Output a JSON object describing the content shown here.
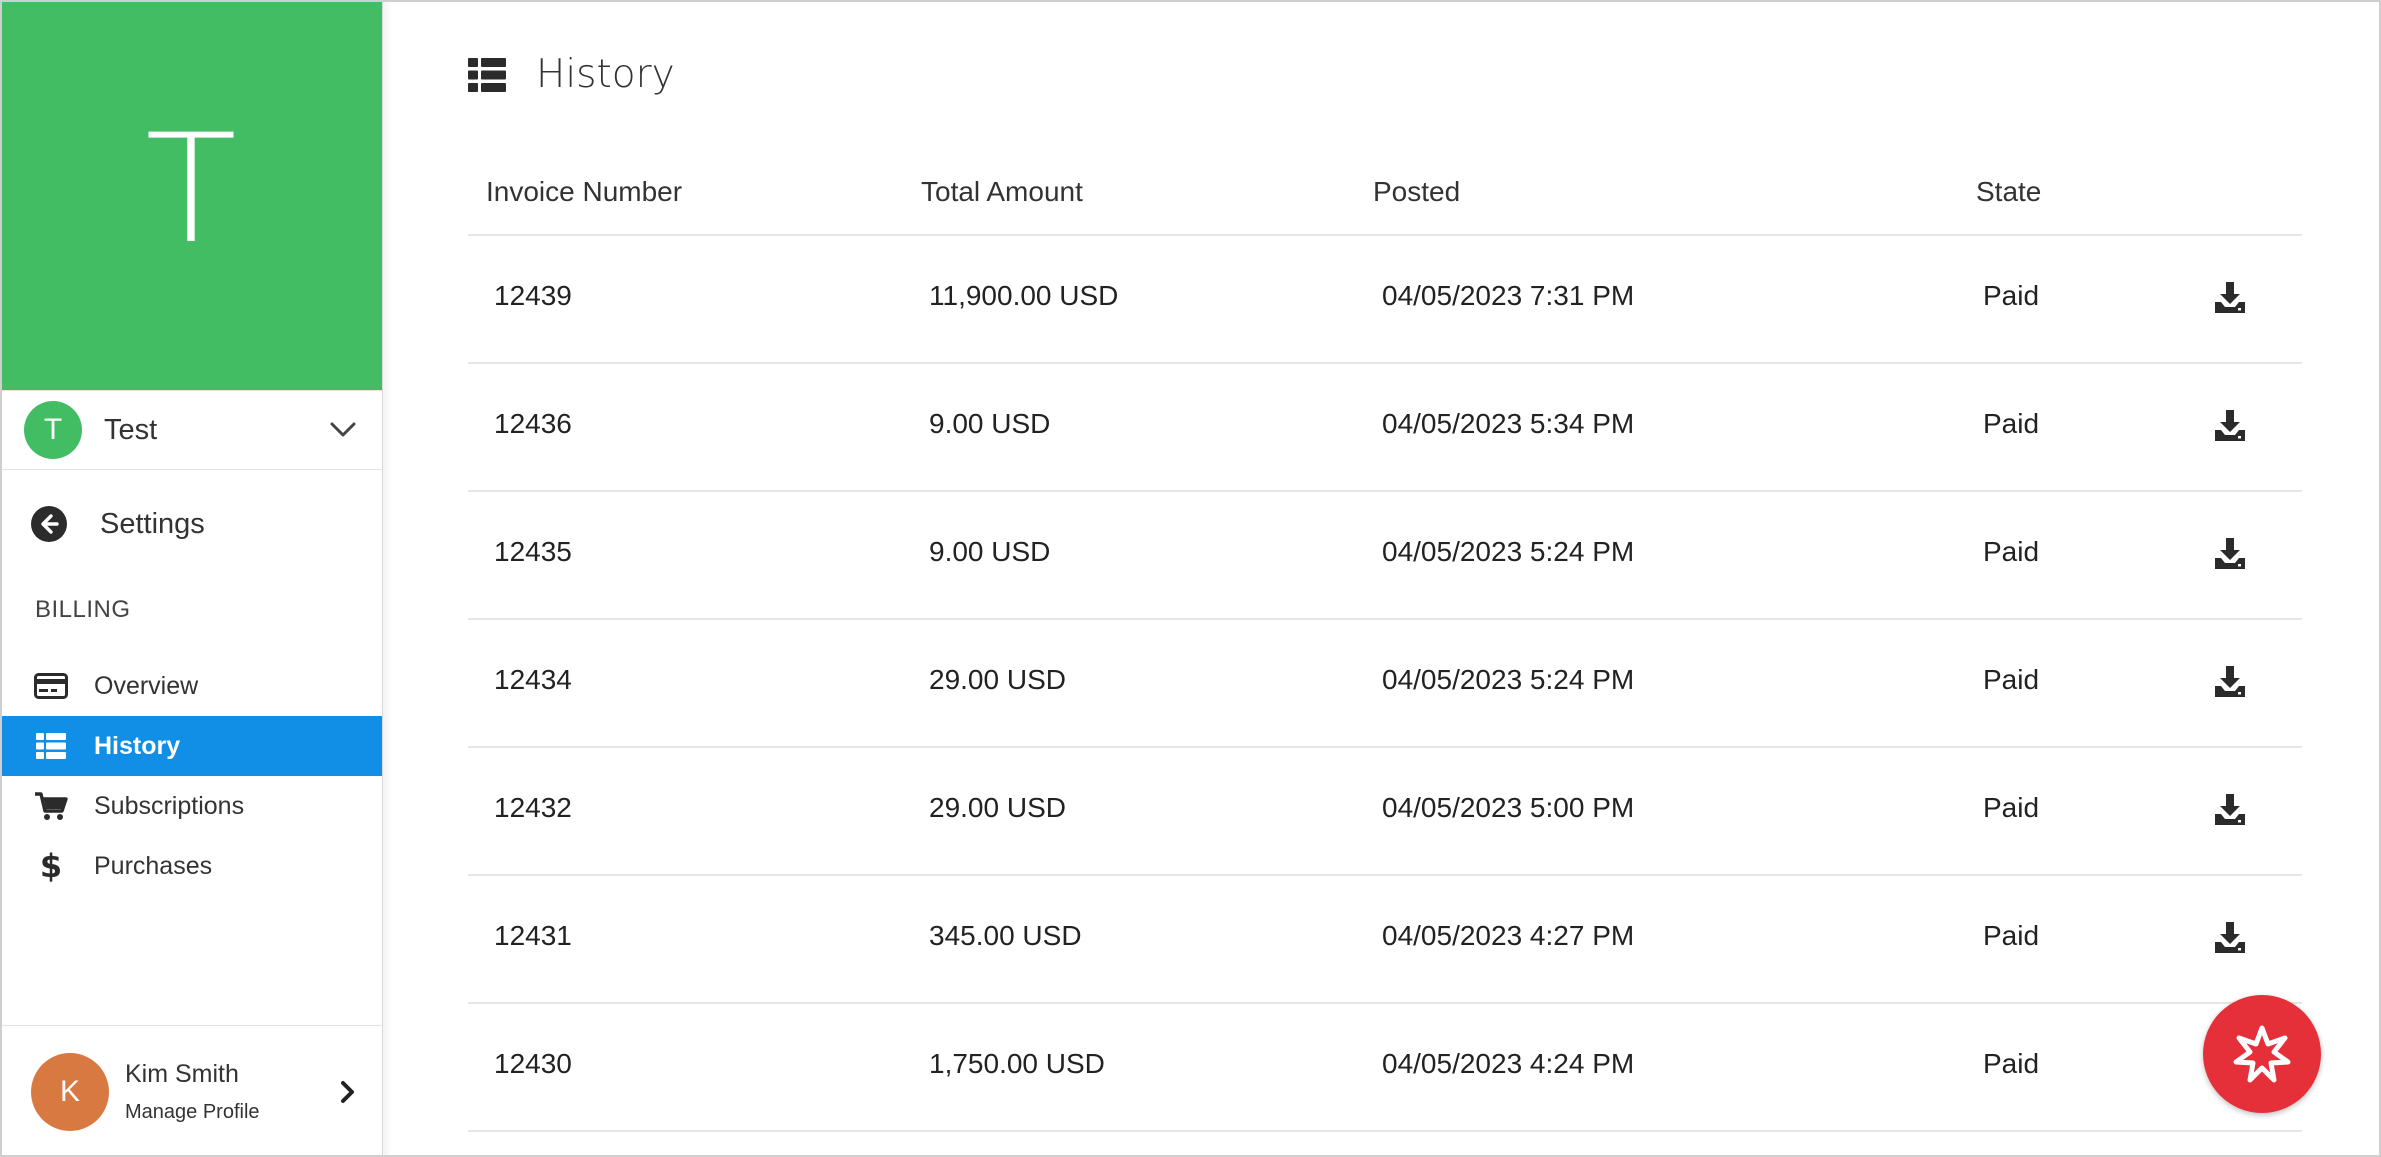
{
  "colors": {
    "brand_green": "#43bd63",
    "active_blue": "#118ee6",
    "profile_orange": "#d97942",
    "fab_red": "#e5303a"
  },
  "sidebar": {
    "hero_letter": "T",
    "workspace": {
      "avatar_letter": "T",
      "name": "Test"
    },
    "back_label": "Settings",
    "section_title": "BILLING",
    "items": [
      {
        "label": "Overview",
        "icon": "credit-card-icon",
        "active": false
      },
      {
        "label": "History",
        "icon": "list-icon",
        "active": true
      },
      {
        "label": "Subscriptions",
        "icon": "cart-icon",
        "active": false
      },
      {
        "label": "Purchases",
        "icon": "dollar-icon",
        "active": false
      }
    ],
    "profile": {
      "avatar_letter": "K",
      "name": "Kim Smith",
      "subtitle": "Manage Profile"
    }
  },
  "main": {
    "title": "History",
    "columns": [
      "Invoice Number",
      "Total Amount",
      "Posted",
      "State"
    ],
    "rows": [
      {
        "invoice": "12439",
        "amount": "11,900.00 USD",
        "posted": "04/05/2023 7:31 PM",
        "state": "Paid"
      },
      {
        "invoice": "12436",
        "amount": "9.00 USD",
        "posted": "04/05/2023 5:34 PM",
        "state": "Paid"
      },
      {
        "invoice": "12435",
        "amount": "9.00 USD",
        "posted": "04/05/2023 5:24 PM",
        "state": "Paid"
      },
      {
        "invoice": "12434",
        "amount": "29.00 USD",
        "posted": "04/05/2023 5:24 PM",
        "state": "Paid"
      },
      {
        "invoice": "12432",
        "amount": "29.00 USD",
        "posted": "04/05/2023 5:00 PM",
        "state": "Paid"
      },
      {
        "invoice": "12431",
        "amount": "345.00 USD",
        "posted": "04/05/2023 4:27 PM",
        "state": "Paid"
      },
      {
        "invoice": "12430",
        "amount": "1,750.00 USD",
        "posted": "04/05/2023 4:24 PM",
        "state": "Paid"
      }
    ]
  }
}
